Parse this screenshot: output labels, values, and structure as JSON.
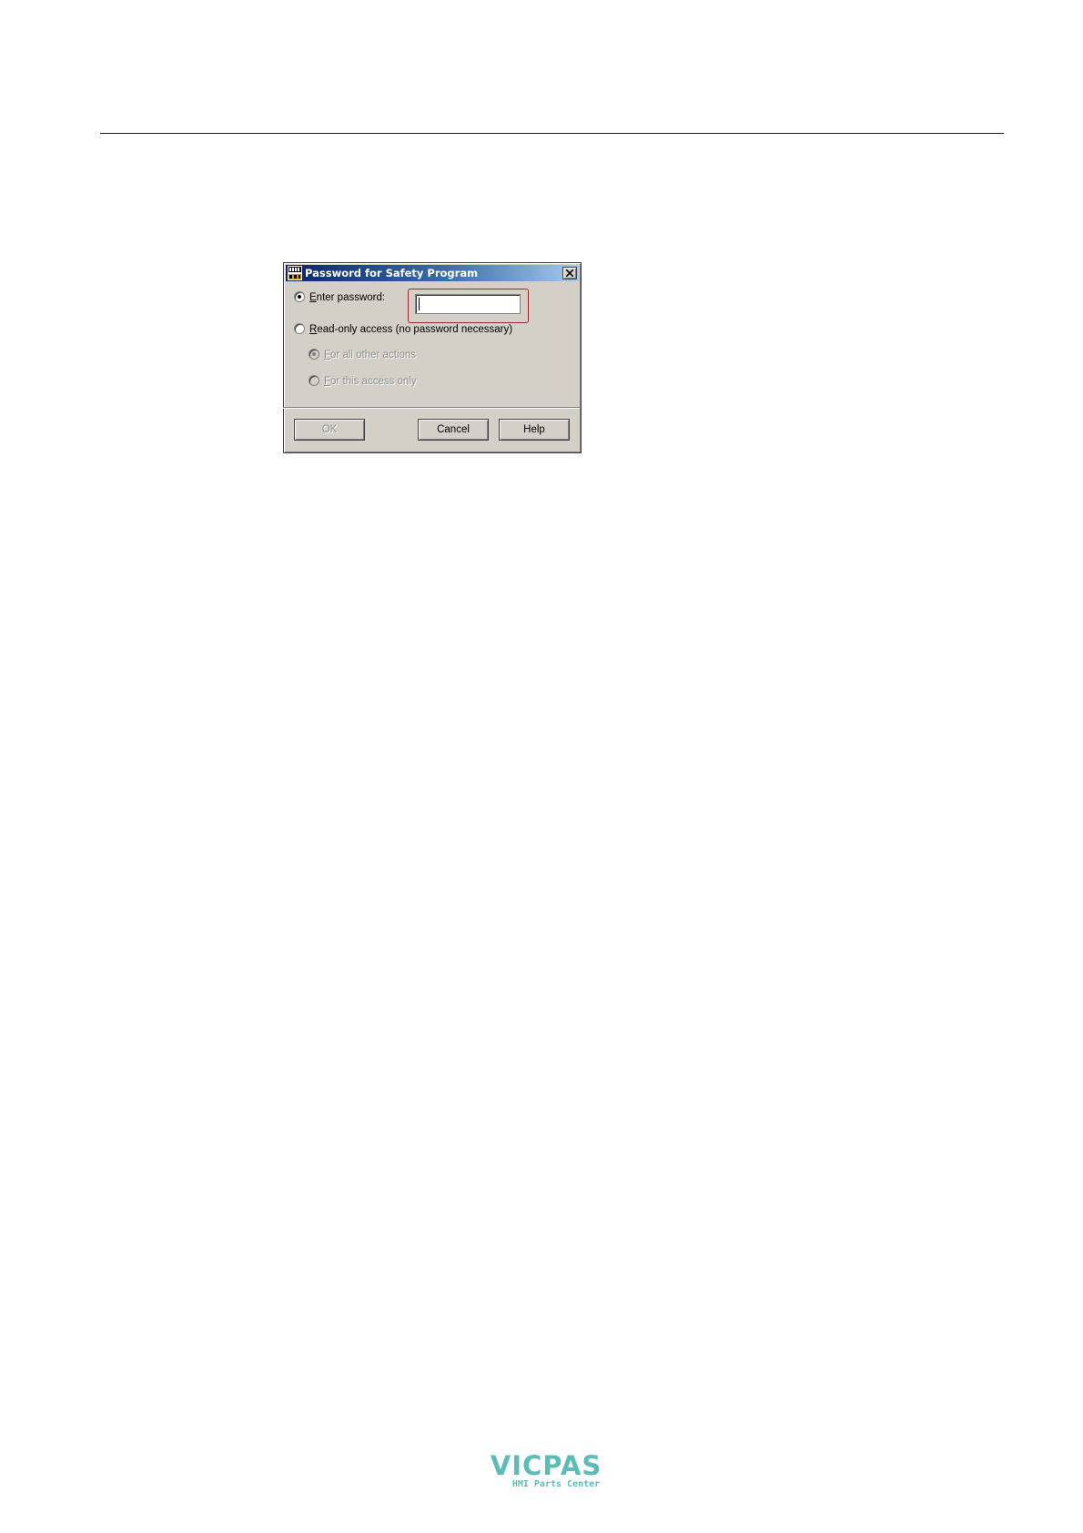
{
  "dialog": {
    "title": "Password for Safety Program",
    "options": {
      "enter_password": {
        "label_prefix": "",
        "accel": "E",
        "label_rest": "nter password:",
        "selected": true
      },
      "read_only": {
        "accel": "R",
        "label_rest": "ead-only access (no password necessary)",
        "selected": false
      },
      "for_all_other_actions": {
        "accel": "F",
        "label_rest": "or all other actions",
        "selected": true,
        "enabled": false
      },
      "for_this_access_only": {
        "accel": "F",
        "label_rest": "or this access only",
        "selected": false,
        "enabled": false
      }
    },
    "password_field": {
      "value": ""
    },
    "buttons": {
      "ok": "OK",
      "cancel": "Cancel",
      "help": "Help"
    }
  },
  "watermark": {
    "brand": "VICPAS",
    "tagline": "HMI Parts Center"
  },
  "colors": {
    "title_bar_start": "#0a246a",
    "highlight_frame": "#a0272d",
    "logo": "#5bbcb8"
  }
}
